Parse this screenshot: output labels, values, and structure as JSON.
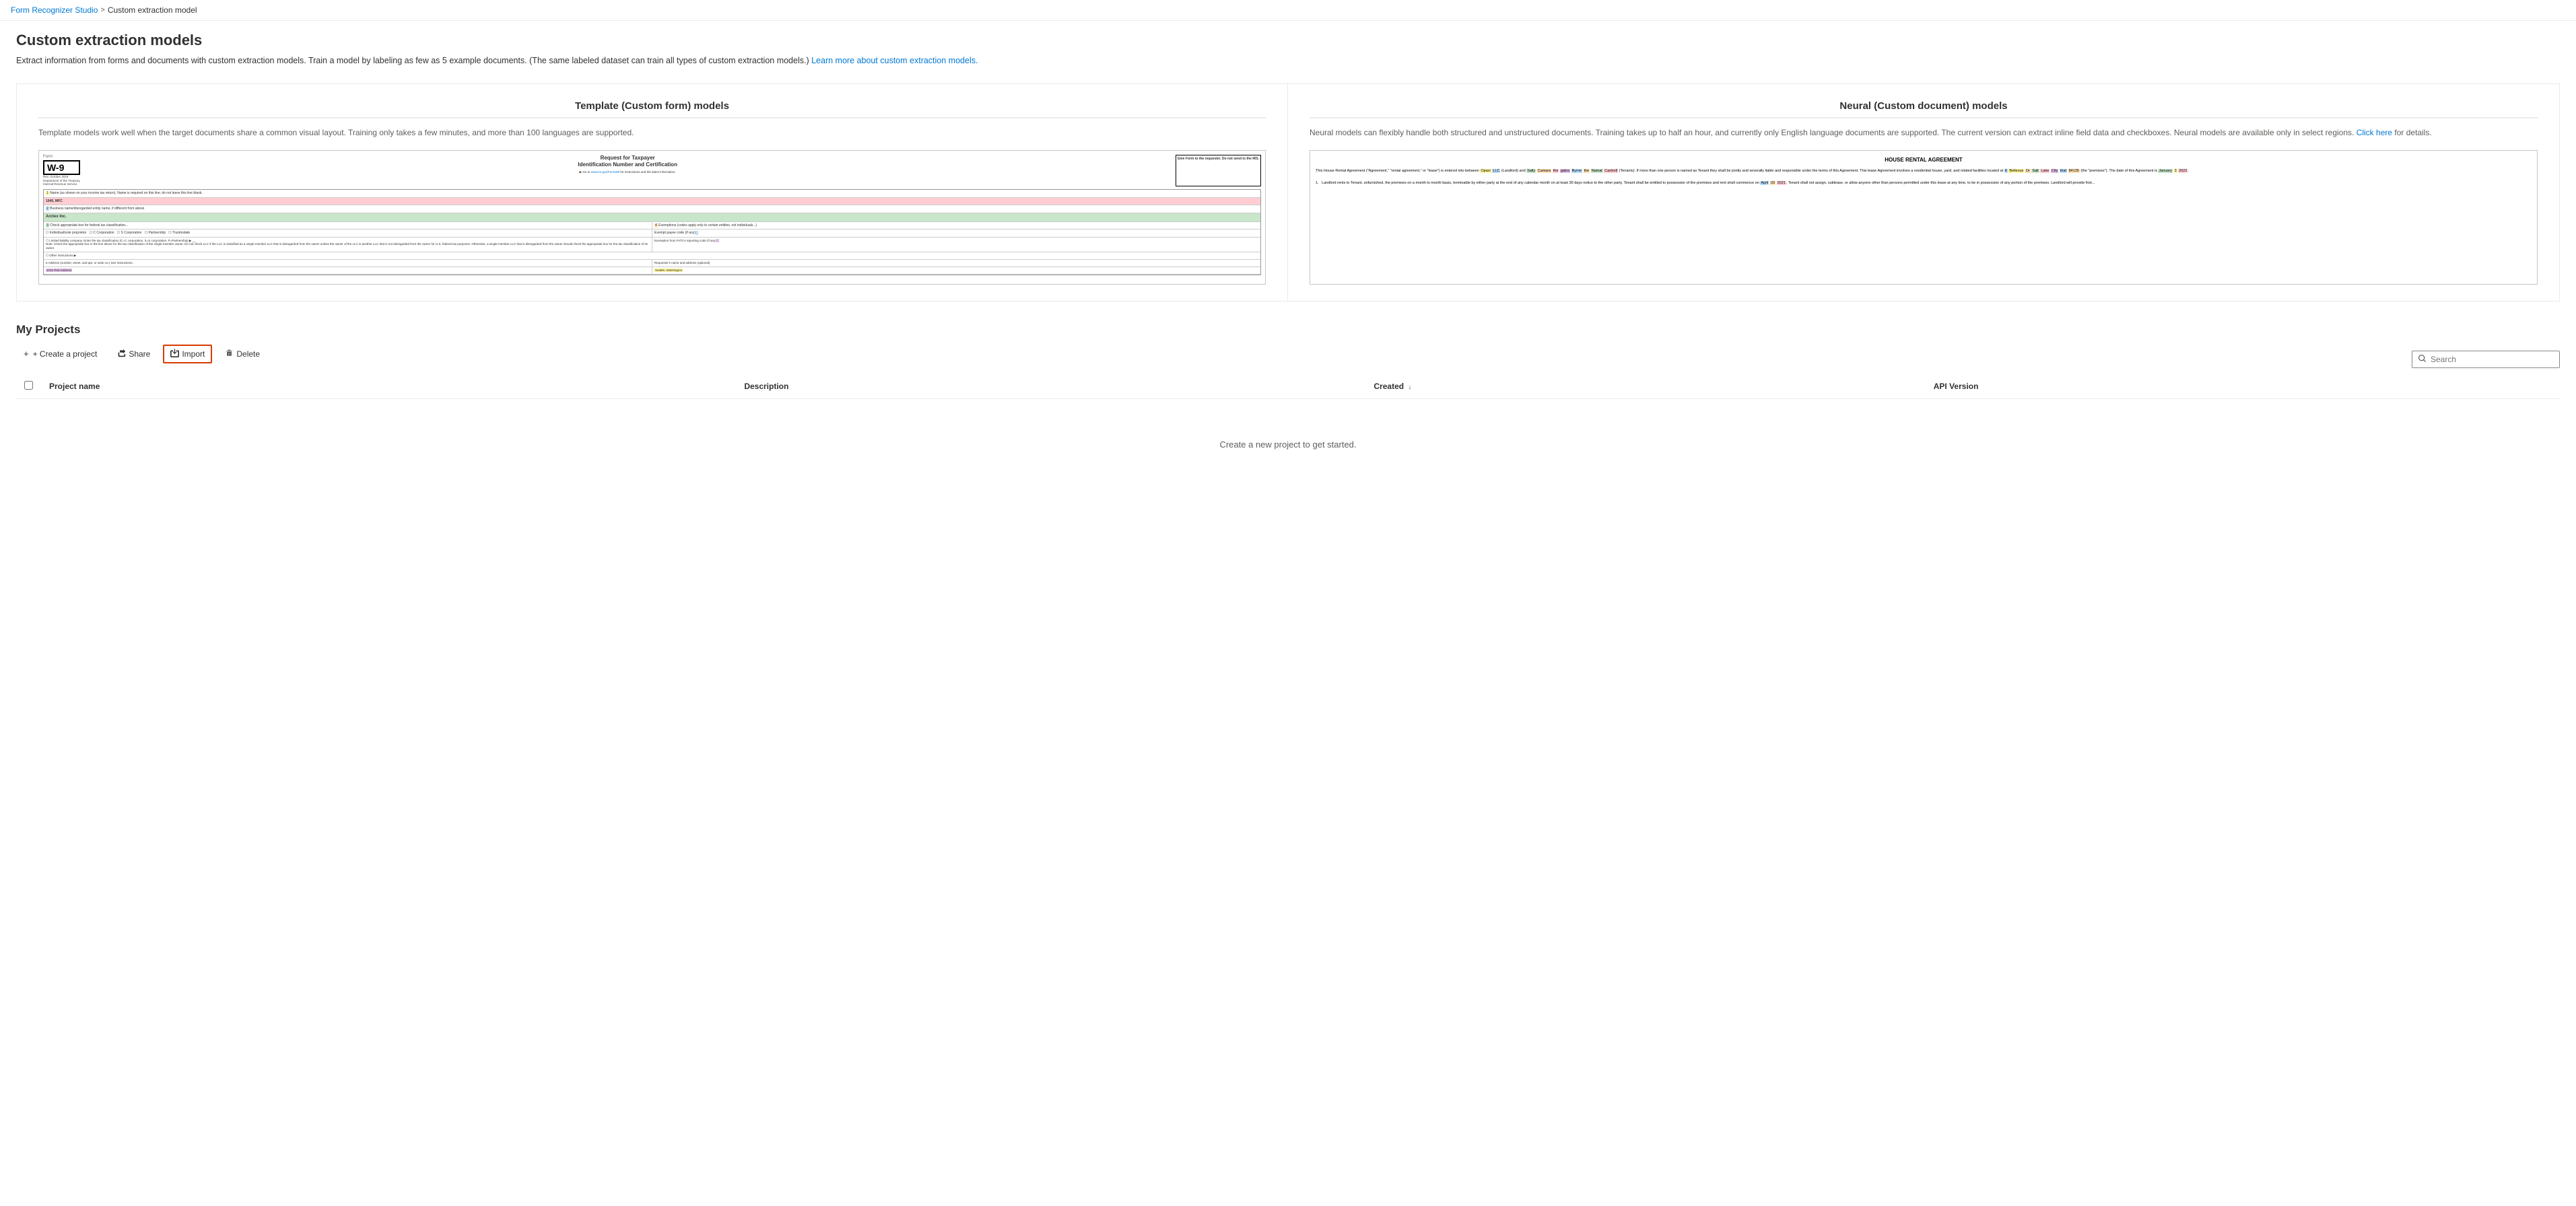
{
  "breadcrumb": {
    "parent_label": "Form Recognizer Studio",
    "parent_url": "#",
    "separator": ">",
    "current": "Custom extraction model"
  },
  "page": {
    "title": "Custom extraction models",
    "description": "Extract information from forms and documents with custom extraction models. Train a model by labeling as few as 5 example documents. (The same labeled dataset can train all types of custom extraction models.)",
    "description_link_text": "Learn more about custom extraction models.",
    "description_link_url": "#"
  },
  "model_cards": [
    {
      "id": "template",
      "title": "Template (Custom form) models",
      "description": "Template models work well when the target documents share a common visual layout. Training only takes a few minutes, and more than 100 languages are supported."
    },
    {
      "id": "neural",
      "title": "Neural (Custom document) models",
      "description": "Neural models can flexibly handle both structured and unstructured documents. Training takes up to half an hour, and currently only English language documents are supported. The current version can extract inline field data and checkboxes. Neural models are available only in select regions.",
      "link_text": "Click here",
      "link_url": "#",
      "description_suffix": " for details."
    }
  ],
  "my_projects": {
    "section_title": "My Projects",
    "toolbar": {
      "create_label": "+ Create a project",
      "share_label": "Share",
      "import_label": "Import",
      "delete_label": "Delete"
    },
    "table": {
      "columns": [
        {
          "id": "project_name",
          "label": "Project name",
          "sortable": false
        },
        {
          "id": "description",
          "label": "Description",
          "sortable": false
        },
        {
          "id": "created",
          "label": "Created",
          "sortable": true,
          "sort_dir": "desc"
        },
        {
          "id": "api_version",
          "label": "API Version",
          "sortable": false
        }
      ],
      "rows": []
    },
    "empty_state": "Create a new project to get started.",
    "search_placeholder": "Search"
  },
  "icons": {
    "share": "↗",
    "import": "⤵",
    "delete": "🗑",
    "search": "🔍",
    "sort_desc": "↓"
  }
}
